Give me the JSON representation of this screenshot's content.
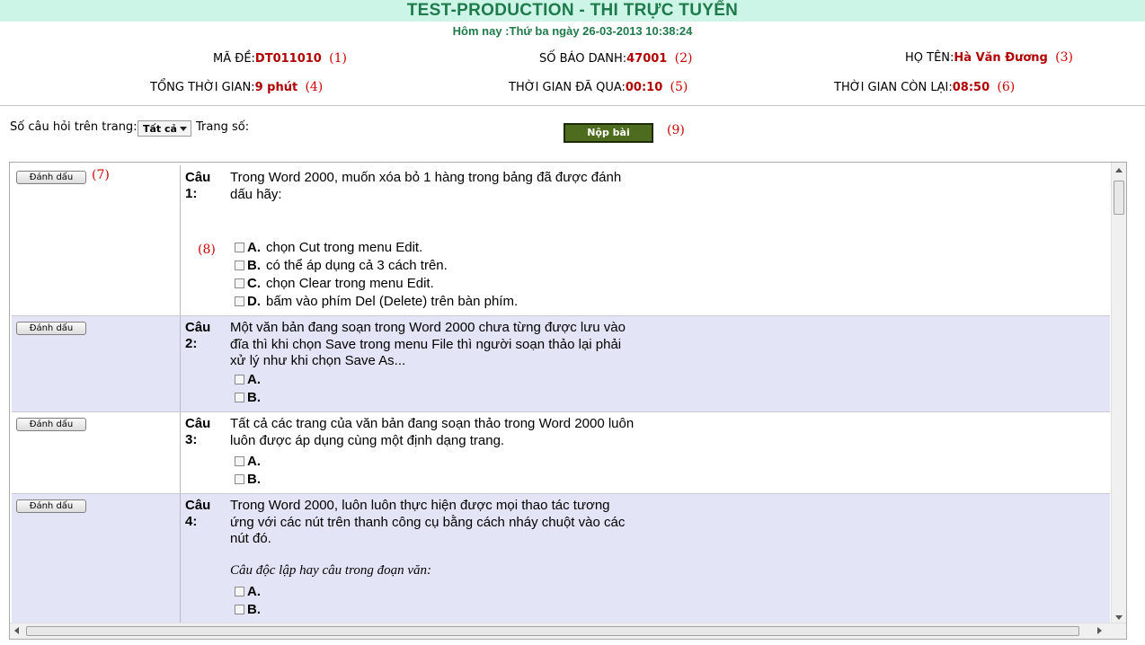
{
  "header": {
    "title": "TEST-PRODUCTION - THI TRỰC TUYẾN",
    "date_line": "Hôm nay :Thứ ba ngày 26-03-2013 10:38:24"
  },
  "info": {
    "exam_code_label": "MÃ ĐỀ:",
    "exam_code_value": "DT011010",
    "exam_code_ann": "(1)",
    "candidate_no_label": "SỐ BÁO DANH:",
    "candidate_no_value": "47001",
    "candidate_no_ann": "(2)",
    "name_label": "HỌ TÊN:",
    "name_value": "Hà Văn Đương",
    "name_ann": "(3)",
    "total_time_label": "TỔNG THỜI GIAN:",
    "total_time_value": "9 phút",
    "total_time_ann": "(4)",
    "elapsed_label": "THỜI GIAN ĐÃ QUA:",
    "elapsed_value": "00:10",
    "elapsed_ann": "(5)",
    "remaining_label": "THỜI GIAN CÒN LẠI:",
    "remaining_value": "08:50",
    "remaining_ann": "(6)"
  },
  "toolbar": {
    "per_page_label": "Số câu hỏi trên trang:",
    "per_page_value": "Tất cả",
    "page_label": "Trang số:",
    "submit_label": "Nộp bài",
    "submit_ann": "(9)"
  },
  "annotations": {
    "mark_ann": "(7)",
    "options_ann": "(8)"
  },
  "questions": [
    {
      "mark_label": "Đánh dấu",
      "num": "Câu 1:",
      "text": "Trong Word 2000, muốn xóa bỏ 1 hàng trong bảng đã được đánh dấu hãy:",
      "options": [
        {
          "letter": "A.",
          "text": "chọn Cut trong menu Edit."
        },
        {
          "letter": "B.",
          "text": "có thể áp dụng cả 3 cách trên."
        },
        {
          "letter": "C.",
          "text": "chọn Clear trong menu Edit."
        },
        {
          "letter": "D.",
          "text": "bấm vào phím Del (Delete) trên bàn phím."
        }
      ]
    },
    {
      "mark_label": "Đánh dấu",
      "num": "Câu 2:",
      "text": "Một văn bản đang soạn trong Word 2000 chưa từng được lưu vào đĩa thì khi chọn Save trong menu File thì người soạn thảo lại phải xử lý như khi chọn Save As...",
      "options": [
        {
          "letter": "A.",
          "text": ""
        },
        {
          "letter": "B.",
          "text": ""
        }
      ]
    },
    {
      "mark_label": "Đánh dấu",
      "num": "Câu 3:",
      "text": "Tất cả các trang của văn bản đang soạn thảo trong Word 2000 luôn luôn được áp dụng cùng một định dạng trang.",
      "options": [
        {
          "letter": "A.",
          "text": ""
        },
        {
          "letter": "B.",
          "text": ""
        }
      ]
    },
    {
      "mark_label": "Đánh dấu",
      "num": "Câu 4:",
      "text": "Trong Word 2000, luôn luôn thực hiện được mọi thao tác tương ứng với các nút trên thanh công cụ bằng cách nháy chuột vào các nút đó.",
      "note": "Câu độc lập hay câu trong đoạn văn:",
      "options": [
        {
          "letter": "A.",
          "text": ""
        },
        {
          "letter": "B.",
          "text": ""
        }
      ]
    }
  ]
}
